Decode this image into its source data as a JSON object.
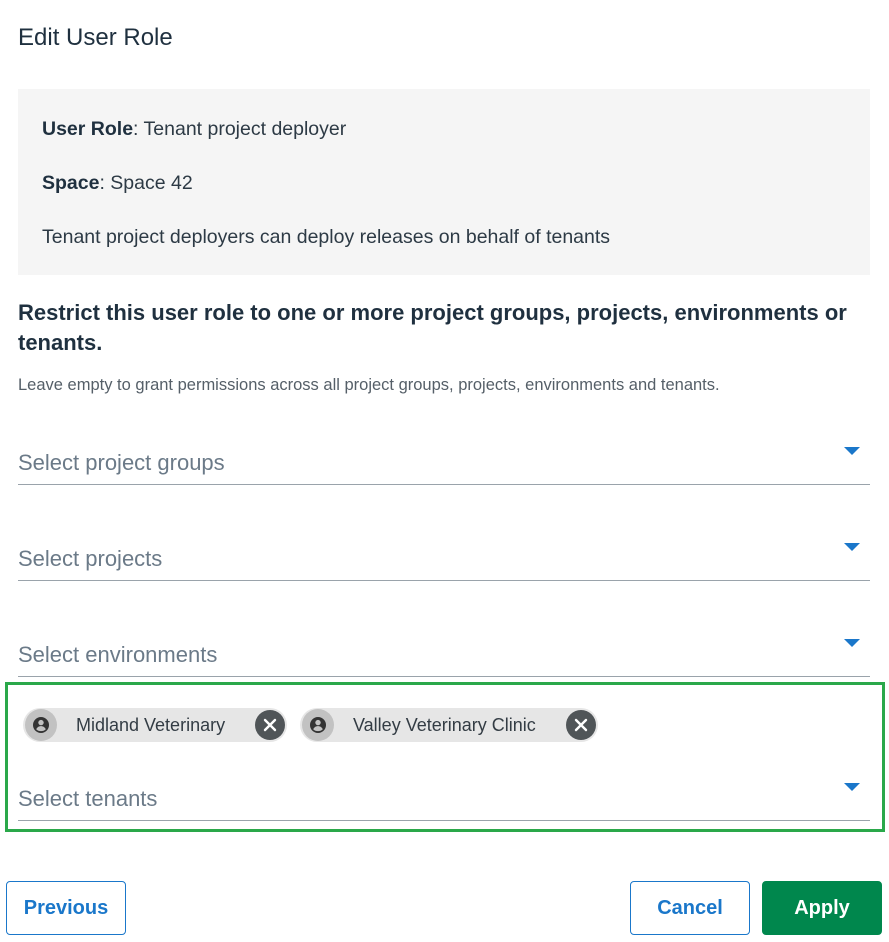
{
  "dialog": {
    "title": "Edit User Role"
  },
  "info": {
    "role_label": "User Role",
    "role_value": ": Tenant project deployer",
    "space_label": "Space",
    "space_value": ": Space 42",
    "description": "Tenant project deployers can deploy releases on behalf of tenants"
  },
  "restrict": {
    "heading": "Restrict this user role to one or more project groups, projects, environments or tenants.",
    "help": "Leave empty to grant permissions across all project groups, projects, environments and tenants."
  },
  "selects": {
    "project_groups": {
      "placeholder": "Select project groups",
      "icon": "caret-down-icon"
    },
    "projects": {
      "placeholder": "Select projects",
      "icon": "caret-down-icon"
    },
    "environments": {
      "placeholder": "Select environments",
      "icon": "caret-down-icon"
    },
    "tenants": {
      "placeholder": "Select tenants",
      "icon": "caret-down-icon",
      "chips": [
        {
          "label": "Midland Veterinary",
          "icon": "tenant-avatar-icon"
        },
        {
          "label": "Valley Veterinary Clinic",
          "icon": "tenant-avatar-icon"
        }
      ]
    }
  },
  "buttons": {
    "previous": "Previous",
    "cancel": "Cancel",
    "apply": "Apply"
  },
  "colors": {
    "accent": "#1a77ca",
    "primary_button": "#00874d",
    "highlight_border": "#2aa84a",
    "panel_background": "#f5f5f5"
  }
}
